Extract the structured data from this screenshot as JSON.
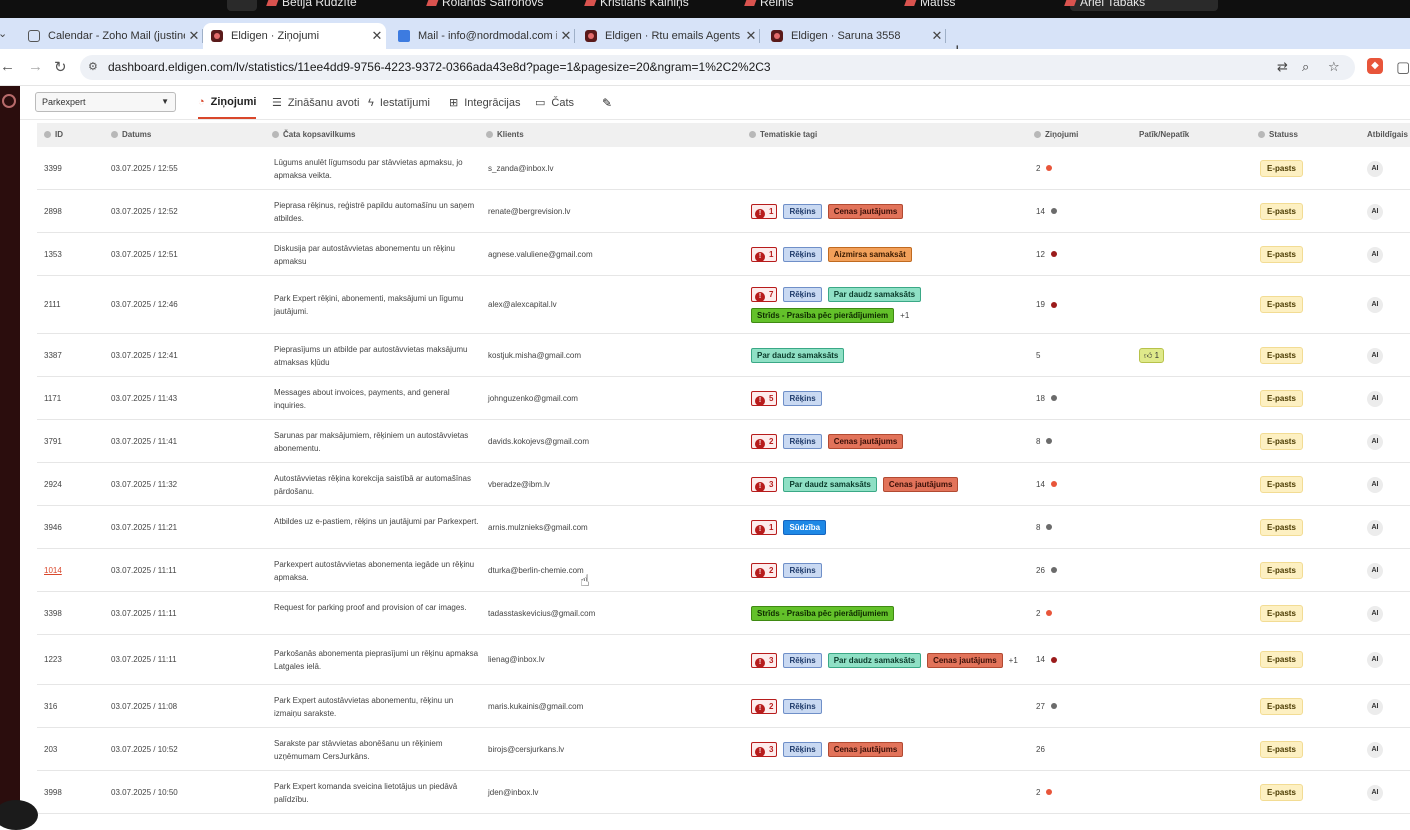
{
  "top_strip": {
    "names": [
      "Betija Rudzīte",
      "Rolands Safronovs",
      "Kristians Kalniņš",
      "Reinis",
      "Matīss",
      "Ariel Tabaks"
    ]
  },
  "browser": {
    "tabs": [
      {
        "title": "Calendar - Zoho Mail (justine.gr",
        "icon": "zoho-icon"
      },
      {
        "title": "Eldigen · Ziņojumi",
        "icon": "eldigen-icon",
        "active": true
      },
      {
        "title": "Mail - info@nordmodal.com inb",
        "icon": "mail-icon"
      },
      {
        "title": "Eldigen · Rtu emails Agents",
        "icon": "eldigen-icon"
      },
      {
        "title": "Eldigen · Saruna 3558",
        "icon": "eldigen-icon"
      }
    ],
    "new_tab": "+",
    "url": "dashboard.eldigen.com/lv/statistics/11ee4dd9-9756-4223-9372-0366ada43e8d?page=1&pagesize=20&ngram=1%2C2%2C3"
  },
  "app": {
    "company_select": "Parkexpert",
    "nav": [
      {
        "label": "Ziņojumi",
        "icon": "pie-icon",
        "active": true
      },
      {
        "label": "Zināšanu avoti",
        "icon": "database-icon"
      },
      {
        "label": "Iestatījumi",
        "icon": "bolt-icon"
      },
      {
        "label": "Integrācijas",
        "icon": "grid-icon"
      },
      {
        "label": "Čats",
        "icon": "chat-icon"
      },
      {
        "label": "",
        "icon": "wrench-icon"
      }
    ]
  },
  "table": {
    "columns": [
      "ID",
      "Datums",
      "Čata kopsavilkums",
      "Klients",
      "Tematiskie tagi",
      "Ziņojumi",
      "Patīk/Nepatīk",
      "Statuss",
      "Atbildīgais"
    ],
    "status_label": "E-pasts",
    "ai_label": "AI",
    "rows": [
      {
        "id": "3399",
        "date": "03.07.2025 / 12:55",
        "summary": "Lūgums anulēt līgumsodu par stāvvietas apmaksu, jo apmaksa veikta.",
        "client": "s_zanda@inbox.lv",
        "tags": [],
        "more": "",
        "messages": "2",
        "dot": "#e8553a",
        "like": "",
        "h": 43
      },
      {
        "id": "2898",
        "date": "03.07.2025 / 12:52",
        "summary": "Pieprasa rēķinus, reģistrē papildu automašīnu un saņem atbildes.",
        "client": "renate@bergrevision.lv",
        "tags": [
          {
            "t": "alert",
            "v": "1"
          },
          {
            "t": "rek",
            "v": "Rēķins"
          },
          {
            "t": "cen",
            "v": "Cenas jautājums"
          }
        ],
        "more": "",
        "messages": "14",
        "dot": "#6b6b6b",
        "like": "",
        "h": 43
      },
      {
        "id": "1353",
        "date": "03.07.2025 / 12:51",
        "summary": "Diskusija par autostāvvietas abonementu un rēķinu apmaksu",
        "client": "agnese.valuliene@gmail.com",
        "tags": [
          {
            "t": "alert",
            "v": "1"
          },
          {
            "t": "rek",
            "v": "Rēķins"
          },
          {
            "t": "aiz",
            "v": "Aizmirsa samaksāt"
          }
        ],
        "more": "",
        "messages": "12",
        "dot": "#9b1b1b",
        "like": "",
        "h": 43
      },
      {
        "id": "2111",
        "date": "03.07.2025 / 12:46",
        "summary": "Park Expert rēķini, abonementi, maksājumi un līgumu jautājumi.",
        "client": "alex@alexcapital.lv",
        "tags": [
          {
            "t": "alert",
            "v": "7"
          },
          {
            "t": "rek",
            "v": "Rēķins"
          },
          {
            "t": "par",
            "v": "Par daudz samaksāts"
          },
          {
            "t": "str",
            "v": "Strīds - Prasība pēc pierādījumiem"
          }
        ],
        "more": "+1",
        "messages": "19",
        "dot": "#9b1b1b",
        "like": "",
        "h": 58
      },
      {
        "id": "3387",
        "date": "03.07.2025 / 12:41",
        "summary": "Pieprasījums un atbilde par autostāvvietas maksājumu atmaksas kļūdu",
        "client": "kostjuk.misha@gmail.com",
        "tags": [
          {
            "t": "par",
            "v": "Par daudz samaksāts"
          }
        ],
        "more": "",
        "messages": "5",
        "dot": "",
        "like": "1",
        "h": 43
      },
      {
        "id": "1171",
        "date": "03.07.2025 / 11:43",
        "summary": "Messages about invoices, payments, and general inquiries.",
        "client": "johnguzenko@gmail.com",
        "tags": [
          {
            "t": "alert",
            "v": "5"
          },
          {
            "t": "rek",
            "v": "Rēķins"
          }
        ],
        "more": "",
        "messages": "18",
        "dot": "#6b6b6b",
        "like": "",
        "h": 43
      },
      {
        "id": "3791",
        "date": "03.07.2025 / 11:41",
        "summary": "Sarunas par maksājumiem, rēķiniem un autostāvvietas abonementu.",
        "client": "davids.kokojevs@gmail.com",
        "tags": [
          {
            "t": "alert",
            "v": "2"
          },
          {
            "t": "rek",
            "v": "Rēķins"
          },
          {
            "t": "cen",
            "v": "Cenas jautājums"
          }
        ],
        "more": "",
        "messages": "8",
        "dot": "#6b6b6b",
        "like": "",
        "h": 43
      },
      {
        "id": "2924",
        "date": "03.07.2025 / 11:32",
        "summary": "Autostāvvietas rēķina korekcija saistībā ar automašīnas pārdošanu.",
        "client": "vberadze@ibm.lv",
        "tags": [
          {
            "t": "alert",
            "v": "3"
          },
          {
            "t": "par",
            "v": "Par daudz samaksāts"
          },
          {
            "t": "cen",
            "v": "Cenas jautājums"
          }
        ],
        "more": "",
        "messages": "14",
        "dot": "#e8553a",
        "like": "",
        "h": 43
      },
      {
        "id": "3946",
        "date": "03.07.2025 / 11:21",
        "summary": "Atbildes uz e-pastiem, rēķins un jautājumi par Parkexpert.",
        "client": "arnis.mulznieks@gmail.com",
        "tags": [
          {
            "t": "alert",
            "v": "1"
          },
          {
            "t": "sud",
            "v": "Sūdzība"
          }
        ],
        "more": "",
        "messages": "8",
        "dot": "#6b6b6b",
        "like": "",
        "h": 43
      },
      {
        "id": "1014",
        "date": "03.07.2025 / 11:11",
        "summary": "Parkexpert autostāvvietas abonementa iegāde un rēķinu apmaksa.",
        "client": "dturka@berlin-chemie.com",
        "tags": [
          {
            "t": "alert",
            "v": "2"
          },
          {
            "t": "rek",
            "v": "Rēķins"
          }
        ],
        "more": "",
        "messages": "26",
        "dot": "#6b6b6b",
        "like": "",
        "h": 43,
        "link": true
      },
      {
        "id": "3398",
        "date": "03.07.2025 / 11:11",
        "summary": "Request for parking proof and provision of car images.",
        "client": "tadasstaskevicius@gmail.com",
        "tags": [
          {
            "t": "str",
            "v": "Strīds - Prasība pēc pierādījumiem"
          }
        ],
        "more": "",
        "messages": "2",
        "dot": "#e8553a",
        "like": "",
        "h": 43
      },
      {
        "id": "1223",
        "date": "03.07.2025 / 11:11",
        "summary": "Parkošanās abonementa pieprasījumi un rēķinu apmaksa Latgales ielā.",
        "client": "lienag@inbox.lv",
        "tags": [
          {
            "t": "alert",
            "v": "3"
          },
          {
            "t": "rek",
            "v": "Rēķins"
          },
          {
            "t": "par",
            "v": "Par daudz samaksāts"
          },
          {
            "t": "cen",
            "v": "Cenas jautājums"
          }
        ],
        "more": "+1",
        "messages": "14",
        "dot": "#9b1b1b",
        "like": "",
        "h": 50
      },
      {
        "id": "316",
        "date": "03.07.2025 / 11:08",
        "summary": "Park Expert autostāvvietas abonementu, rēķinu un izmaiņu sarakste.",
        "client": "maris.kukainis@gmail.com",
        "tags": [
          {
            "t": "alert",
            "v": "2"
          },
          {
            "t": "rek",
            "v": "Rēķins"
          }
        ],
        "more": "",
        "messages": "27",
        "dot": "#6b6b6b",
        "like": "",
        "h": 43
      },
      {
        "id": "203",
        "date": "03.07.2025 / 10:52",
        "summary": "Sarakste par stāvvietas abonēšanu un rēķiniem uzņēmumam CersJurkāns.",
        "client": "birojs@cersjurkans.lv",
        "tags": [
          {
            "t": "alert",
            "v": "3"
          },
          {
            "t": "rek",
            "v": "Rēķins"
          },
          {
            "t": "cen",
            "v": "Cenas jautājums"
          }
        ],
        "more": "",
        "messages": "26",
        "dot": "",
        "like": "",
        "h": 43
      },
      {
        "id": "3998",
        "date": "03.07.2025 / 10:50",
        "summary": "Park Expert komanda sveicina lietotājus un piedāvā palīdzību.",
        "client": "jden@inbox.lv",
        "tags": [],
        "more": "",
        "messages": "2",
        "dot": "#e8553a",
        "like": "",
        "h": 43
      }
    ]
  }
}
